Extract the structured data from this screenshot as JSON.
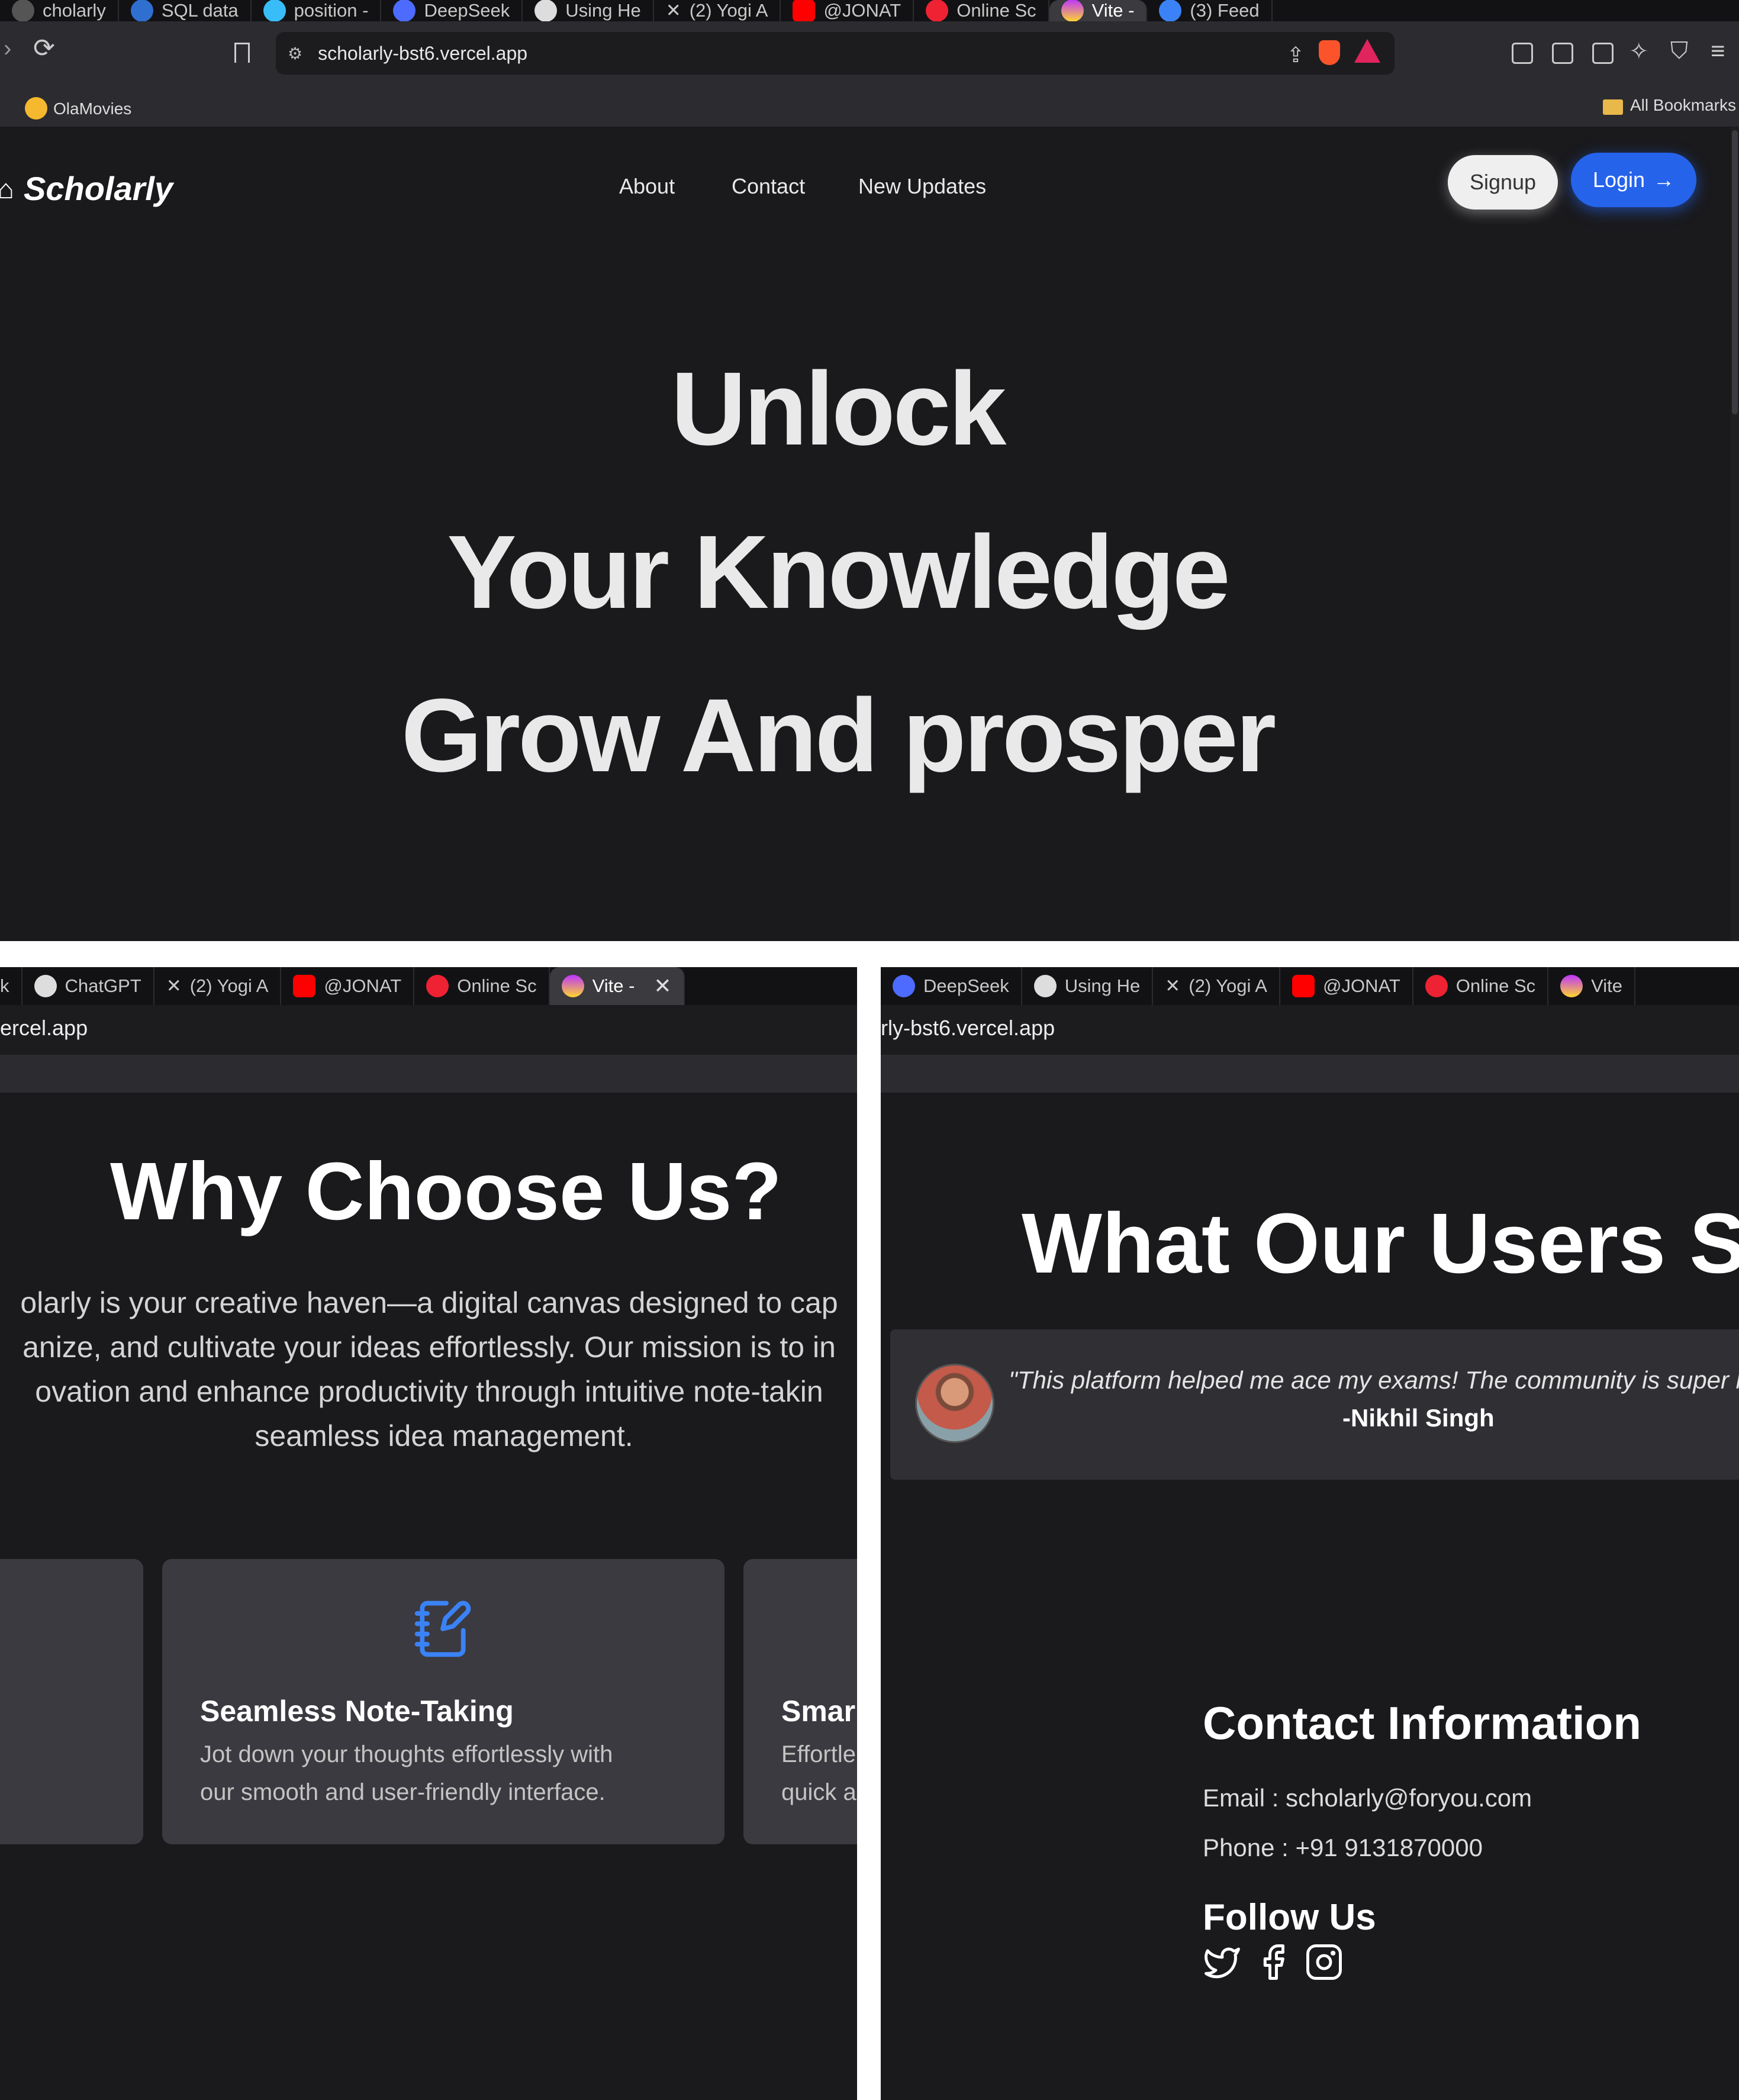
{
  "top_panel": {
    "tabs": [
      {
        "label": "cholarly"
      },
      {
        "label": "SQL data"
      },
      {
        "label": "position -"
      },
      {
        "label": "DeepSeek"
      },
      {
        "label": "Using He"
      },
      {
        "label": "(2) Yogi A"
      },
      {
        "label": "@JONAT"
      },
      {
        "label": "Online Sc"
      },
      {
        "label": "Vite -",
        "active": true
      },
      {
        "label": "(3) Feed"
      }
    ],
    "url": "scholarly-bst6.vercel.app",
    "bookmarks": {
      "item": "OlaMovies",
      "all_bookmarks": "All Bookmarks"
    },
    "site": {
      "logo": "Scholarly",
      "nav": [
        "About",
        "Contact",
        "New Updates"
      ],
      "signup": "Signup",
      "login": "Login",
      "login_arrow": "→",
      "hero_lines": [
        "Unlock",
        "Your Knowledge",
        "Grow And prosper"
      ]
    }
  },
  "bottom_left_panel": {
    "tabs": [
      {
        "label": "k"
      },
      {
        "label": "ChatGPT"
      },
      {
        "label": "(2) Yogi A"
      },
      {
        "label": "@JONAT"
      },
      {
        "label": "Online Sc"
      },
      {
        "label": "Vite -",
        "active": true,
        "close": "✕"
      }
    ],
    "url": "ercel.app",
    "why_title": "Why Choose Us?",
    "why_lines": [
      "olarly is your creative haven—a digital canvas designed to cap",
      "anize, and cultivate your ideas effortlessly. Our mission is to in",
      "ovation and enhance productivity through intuitive note-takin",
      "seamless idea management."
    ],
    "cards": [
      {
        "title": "Seamless Note-Taking",
        "desc": [
          "Jot down your thoughts effortlessly with",
          "our smooth and user-friendly interface."
        ]
      },
      {
        "title": "Smar",
        "desc": [
          "Effortle",
          "quick a"
        ]
      }
    ]
  },
  "bottom_right_panel": {
    "tabs": [
      {
        "label": "DeepSeek"
      },
      {
        "label": "Using He"
      },
      {
        "label": "(2) Yogi A"
      },
      {
        "label": "@JONAT"
      },
      {
        "label": "Online Sc"
      },
      {
        "label": "Vite"
      }
    ],
    "url": "rly-bst6.vercel.app",
    "users_title": "What Our Users Sa",
    "testimonial": {
      "quote": "\"This platform helped me ace my exams! The community is super he",
      "author": "-Nikhil Singh"
    },
    "contact": {
      "title": "Contact Information",
      "email": "Email : scholarly@foryou.com",
      "phone": "Phone : +91 9131870000",
      "follow": "Follow Us",
      "socials": [
        "twitter-icon",
        "facebook-icon",
        "instagram-icon"
      ]
    }
  },
  "colors": {
    "page_bg": "#1a1a1d",
    "accent_blue": "#2563eb",
    "card_bg": "#3a3a40"
  }
}
